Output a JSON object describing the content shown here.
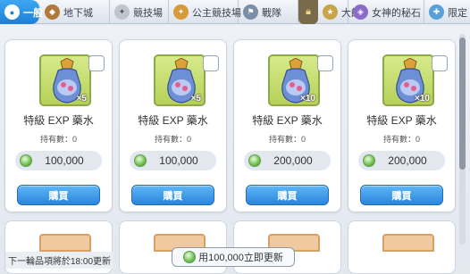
{
  "tabs": [
    {
      "label": "一般",
      "icon": "circle-icon",
      "active": true
    },
    {
      "label": "地下城",
      "icon": "dungeon-icon",
      "active": false
    },
    {
      "label": "競技場",
      "icon": "arena-icon",
      "active": false
    },
    {
      "label": "公主競技場",
      "icon": "princess-arena-icon",
      "active": false
    },
    {
      "label": "戰隊",
      "icon": "clan-icon",
      "active": false
    },
    {
      "label": "大師",
      "icon": "master-icon",
      "active": false
    },
    {
      "label": "女神的秘石",
      "icon": "goddess-stone-icon",
      "active": false
    },
    {
      "label": "限定",
      "icon": "limited-icon",
      "active": false
    }
  ],
  "items": [
    {
      "name": "特級 EXP 藥水",
      "quantity": "×5",
      "owned": "持有數：0",
      "price": "100,000",
      "buy": "購買"
    },
    {
      "name": "特級 EXP 藥水",
      "quantity": "×5",
      "owned": "持有數：0",
      "price": "100,000",
      "buy": "購買"
    },
    {
      "name": "特級 EXP 藥水",
      "quantity": "×10",
      "owned": "持有數：0",
      "price": "200,000",
      "buy": "購買"
    },
    {
      "name": "特級 EXP 藥水",
      "quantity": "×10",
      "owned": "持有數：0",
      "price": "200,000",
      "buy": "購買"
    }
  ],
  "footer": {
    "next_refresh": "下一輪品項將於18:00更新",
    "refresh_button": "用100,000立即更新"
  },
  "colors": {
    "accent": "#2a86dc",
    "active_tab": "#1c7fd6",
    "gem": "#6fbf55"
  }
}
